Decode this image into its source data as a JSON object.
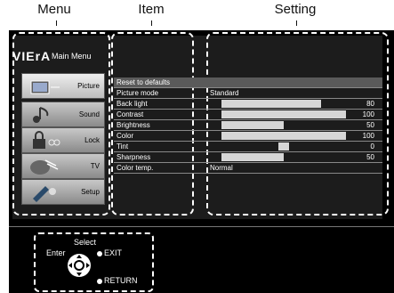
{
  "labels": {
    "menu": "Menu",
    "item": "Item",
    "setting": "Setting"
  },
  "brand": {
    "logo": "VIErA",
    "title": "Main Menu"
  },
  "menu": [
    {
      "label": "Picture",
      "icon": "picture-icon",
      "active": true
    },
    {
      "label": "Sound",
      "icon": "sound-icon",
      "active": false
    },
    {
      "label": "Lock",
      "icon": "lock-icon",
      "active": false
    },
    {
      "label": "TV",
      "icon": "tv-icon",
      "active": false
    },
    {
      "label": "Setup",
      "icon": "setup-icon",
      "active": false
    }
  ],
  "items": [
    {
      "label": "Reset to defaults",
      "setting": "",
      "value": ""
    },
    {
      "label": "Picture mode",
      "setting": "Standard",
      "value": ""
    },
    {
      "label": "Back light",
      "setting": "",
      "value": "80",
      "level": 0.8
    },
    {
      "label": "Contrast",
      "setting": "",
      "value": "100",
      "level": 1.0
    },
    {
      "label": "Brightness",
      "setting": "",
      "value": "50",
      "level": 0.5
    },
    {
      "label": "Color",
      "setting": "",
      "value": "100",
      "level": 1.0
    },
    {
      "label": "Tint",
      "setting": "",
      "value": "0",
      "centered": true
    },
    {
      "label": "Sharpness",
      "setting": "",
      "value": "50",
      "level": 0.5
    },
    {
      "label": "Color temp.",
      "setting": "Normal",
      "value": ""
    }
  ],
  "nav": {
    "select": "Select",
    "enter": "Enter",
    "exit": "EXIT",
    "return": "RETURN"
  },
  "colors": {
    "screen": "#000000",
    "panel": "#1c1c1c",
    "item_highlight": "#5a5a5a",
    "bar": "#d6d6d6"
  }
}
